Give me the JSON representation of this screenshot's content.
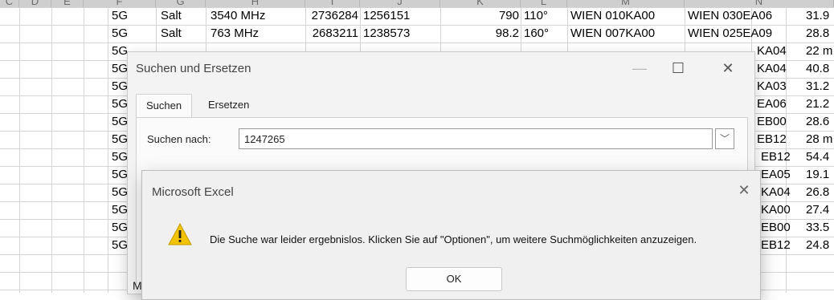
{
  "sheet": {
    "col_headers": [
      "C",
      "D",
      "E",
      "F",
      "G",
      "H",
      "I",
      "J",
      "K",
      "L",
      "M",
      "N"
    ],
    "rows": [
      [
        "5G",
        "Salt",
        "3540 MHz",
        "2736284",
        "1256151",
        "790",
        "110°",
        "WIEN 010KA00",
        "WIEN 030EA06",
        "31.9"
      ],
      [
        "5G",
        "Salt",
        "763 MHz",
        "2683211",
        "1238573",
        "98.2",
        "160°",
        "WIEN 007KA00",
        "WIEN 025EA09",
        "28.8"
      ]
    ],
    "partial_rows": [
      {
        "a": "5G",
        "n": "KA04",
        "o": "22 m"
      },
      {
        "a": "5G",
        "n": "KA04",
        "o": "40.8"
      },
      {
        "a": "5G",
        "n": "KA03",
        "o": "31.2"
      },
      {
        "a": "5G",
        "n": "EA06",
        "o": "21.2"
      },
      {
        "a": "5G",
        "n": "EB00",
        "o": "28.6"
      },
      {
        "a": "5G",
        "n": "EB12",
        "o": "28 m"
      },
      {
        "a": "5G",
        "n": "EB12",
        "o": "54.4"
      },
      {
        "a": "5G",
        "n": "EA05",
        "o": "19.1"
      },
      {
        "a": "5G",
        "n": "KA04",
        "o": "26.8"
      },
      {
        "a": "5G",
        "n": "KA00",
        "o": "27.4"
      },
      {
        "a": "5G",
        "n": "EB00",
        "o": "33.5"
      },
      {
        "a": "5G",
        "n": "EB12",
        "o": "24.8"
      }
    ]
  },
  "find_dialog": {
    "title": "Suchen und Ersetzen",
    "minimize_icon": "—",
    "maximize_icon": "☐",
    "close_icon": "✕",
    "tabs": [
      "Suchen",
      "Ersetzen"
    ],
    "search_label": "Suchen nach:",
    "search_value": "1247265",
    "dropdown_icon": "﹀",
    "partial_label": "M"
  },
  "message_dialog": {
    "title": "Microsoft Excel",
    "close_icon": "✕",
    "message": "Die Suche war leider ergebnislos. Klicken Sie auf \"Optionen\", um weitere Suchmöglichkeiten anzuzeigen.",
    "ok_label": "OK",
    "warning_color": "#f2c300"
  }
}
